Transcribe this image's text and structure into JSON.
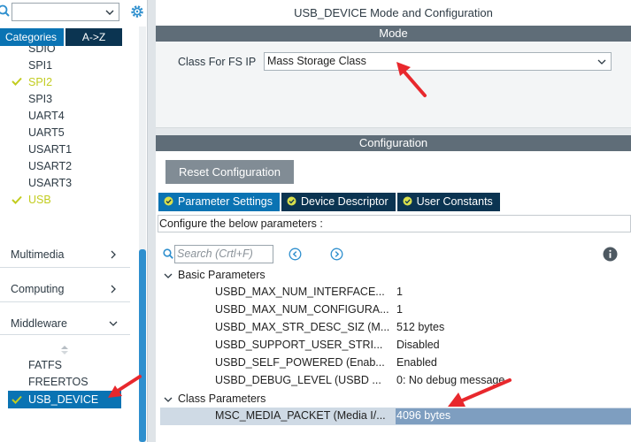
{
  "left_panel": {
    "search": {
      "value": ""
    },
    "tabs": {
      "categories": "Categories",
      "az": "A->Z"
    },
    "connectivity_items": [
      {
        "label": "SDIO",
        "selected": false
      },
      {
        "label": "SPI1",
        "selected": false
      },
      {
        "label": "SPI2",
        "selected": true
      },
      {
        "label": "SPI3",
        "selected": false
      },
      {
        "label": "UART4",
        "selected": false
      },
      {
        "label": "UART5",
        "selected": false
      },
      {
        "label": "USART1",
        "selected": false
      },
      {
        "label": "USART2",
        "selected": false
      },
      {
        "label": "USART3",
        "selected": false
      },
      {
        "label": "USB",
        "selected": true
      }
    ],
    "sections": {
      "multimedia": "Multimedia",
      "computing": "Computing",
      "middleware": "Middleware"
    },
    "middleware_items": [
      {
        "label": "FATFS"
      },
      {
        "label": "FREERTOS"
      },
      {
        "label": "USB_DEVICE"
      }
    ]
  },
  "main": {
    "title": "USB_DEVICE Mode and Configuration",
    "mode_bar": "Mode",
    "class_label": "Class For FS IP",
    "class_value": "Mass Storage Class",
    "config_bar": "Configuration",
    "reset_button": "Reset Configuration",
    "tabs": [
      {
        "label": "Parameter Settings"
      },
      {
        "label": "Device Descriptor"
      },
      {
        "label": "User Constants"
      }
    ],
    "configure_text": "Configure the below parameters :",
    "search_placeholder": "Search (Crtl+F)",
    "groups": {
      "basic": "Basic Parameters",
      "class": "Class Parameters"
    },
    "basic_params": [
      {
        "name": "USBD_MAX_NUM_INTERFACE...",
        "value": "1"
      },
      {
        "name": "USBD_MAX_NUM_CONFIGURA...",
        "value": "1"
      },
      {
        "name": "USBD_MAX_STR_DESC_SIZ (M...",
        "value": "512 bytes"
      },
      {
        "name": "USBD_SUPPORT_USER_STRI...",
        "value": "Disabled"
      },
      {
        "name": "USBD_SELF_POWERED (Enab...",
        "value": "Enabled"
      },
      {
        "name": "USBD_DEBUG_LEVEL (USBD ...",
        "value": "0: No debug message"
      }
    ],
    "class_params": [
      {
        "name": "MSC_MEDIA_PACKET (Media I/...",
        "value": "4096 bytes"
      }
    ]
  },
  "colors": {
    "accent_blue": "#0a73b3",
    "dark_tab": "#0b3451",
    "bar_gray": "#5f6d78",
    "selected_green": "#c2cc1f",
    "annotation_red": "#e8282d"
  }
}
